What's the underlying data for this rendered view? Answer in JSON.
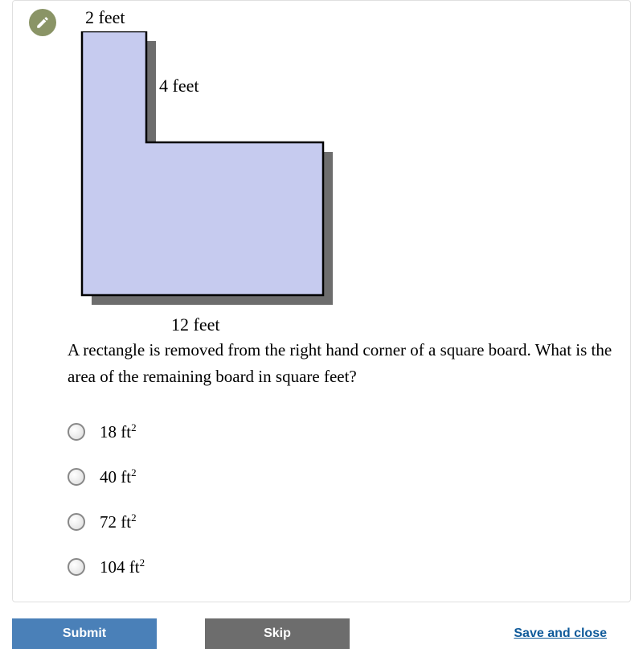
{
  "diagram": {
    "label_top": "2 feet",
    "label_right": "4 feet",
    "label_bottom": "12 feet"
  },
  "question": "A rectangle is removed from the right hand corner of a square board. What is the area of the remaining board in square feet?",
  "options": [
    {
      "value": "18",
      "unit": "ft",
      "exp": "2"
    },
    {
      "value": "40",
      "unit": "ft",
      "exp": "2"
    },
    {
      "value": "72",
      "unit": "ft",
      "exp": "2"
    },
    {
      "value": "104",
      "unit": "ft",
      "exp": "2"
    }
  ],
  "buttons": {
    "submit": "Submit",
    "skip": "Skip",
    "save": "Save and close"
  }
}
